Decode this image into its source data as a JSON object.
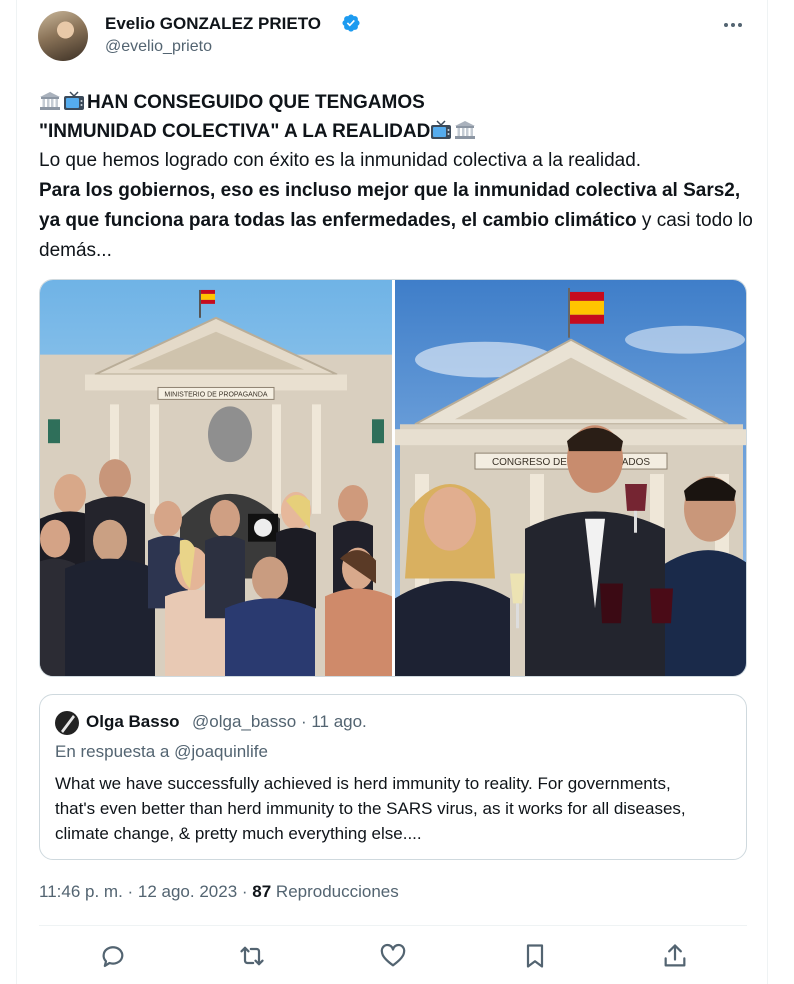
{
  "author": {
    "display_name": "Evelio GONZALEZ PRIETO",
    "handle": "@evelio_prieto",
    "verified": true
  },
  "post": {
    "headline_line1": "HAN CONSEGUIDO QUE TENGAMOS",
    "headline_line2": "\"INMUNIDAD COLECTIVA\" A LA REALIDAD",
    "body_plain_1": "Lo que hemos logrado con éxito es la inmunidad colectiva a la realidad.",
    "body_bold": "Para los gobiernos, eso es incluso mejor que la inmunidad colectiva al Sars2, ya que funciona para todas las enfermedades, el cambio climático",
    "body_plain_2": " y casi todo lo demás...",
    "images": {
      "left_sign": "MINISTERIO DE PROPAGANDA",
      "right_sign": "CONGRESO DE LOS DIPUTADOS"
    }
  },
  "quoted": {
    "name": "Olga Basso",
    "meta": "@olga_basso · 11 ago.",
    "reply_prefix": "En respuesta a",
    "reply_to": "@joaquinlife",
    "text": "What we have successfully achieved is herd immunity to reality. For governments, that's even better than herd immunity to the SARS virus, as it works for all diseases, climate change, & pretty much everything else...."
  },
  "meta": {
    "time": "11:46 p. m. · 12 ago. 2023 · ",
    "views_count": "87",
    "views_label": " Reproducciones"
  },
  "colors": {
    "accent": "#1d9bf0",
    "secondary_text": "#536471",
    "border": "#cfd9de"
  },
  "icons": [
    "verified-badge-icon",
    "more-icon",
    "classical-building-icon",
    "television-icon",
    "reply-icon",
    "retweet-icon",
    "like-icon",
    "bookmark-icon",
    "share-icon"
  ]
}
